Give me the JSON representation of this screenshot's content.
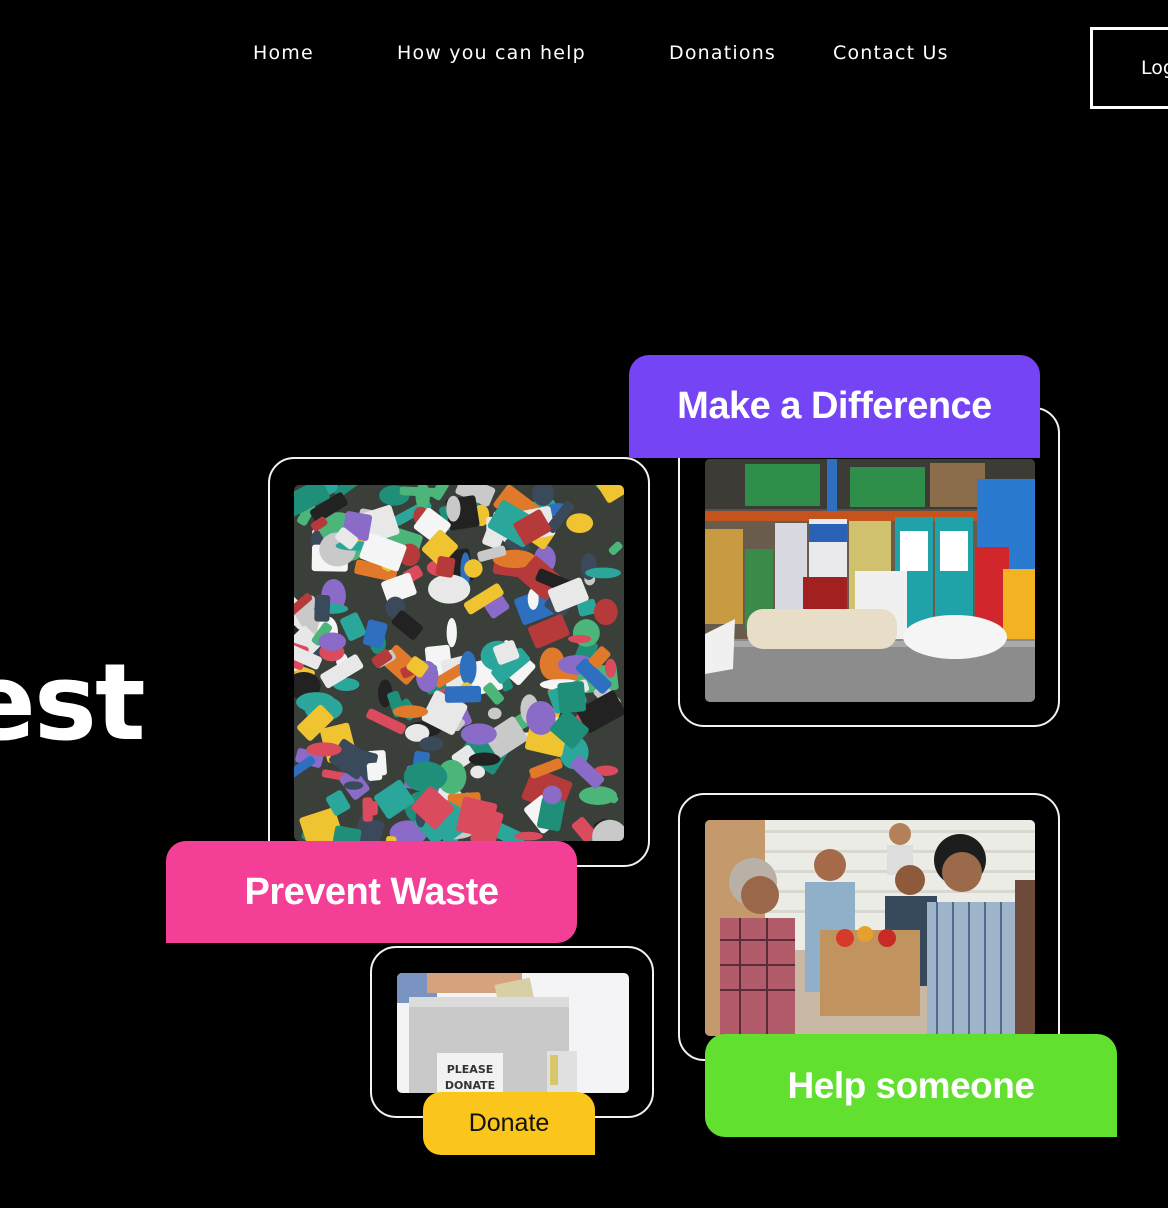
{
  "nav": {
    "items": [
      {
        "label": "Home"
      },
      {
        "label": "How you can help"
      },
      {
        "label": "Donations"
      },
      {
        "label": "Contact Us"
      }
    ],
    "login_label": "Log"
  },
  "hero": {
    "visible_fragment": "est"
  },
  "tiles": [
    {
      "label": "Make a Difference",
      "color": "#7544f5",
      "photo": "food-bank-shelves-photo"
    },
    {
      "label": "Prevent Waste",
      "color": "#f43f97",
      "photo": "plastic-waste-pile-photo"
    },
    {
      "label": "Help someone",
      "color": "#62e02f",
      "photo": "family-receiving-groceries-photo"
    },
    {
      "label": "Donate",
      "color": "#fbc61b",
      "photo": "donation-box-photo"
    }
  ],
  "donation_box_text": [
    "PLEASE",
    "DONATE"
  ],
  "colors": {
    "background": "#000000",
    "text": "#ffffff",
    "card_border": "#f2f2f2"
  }
}
